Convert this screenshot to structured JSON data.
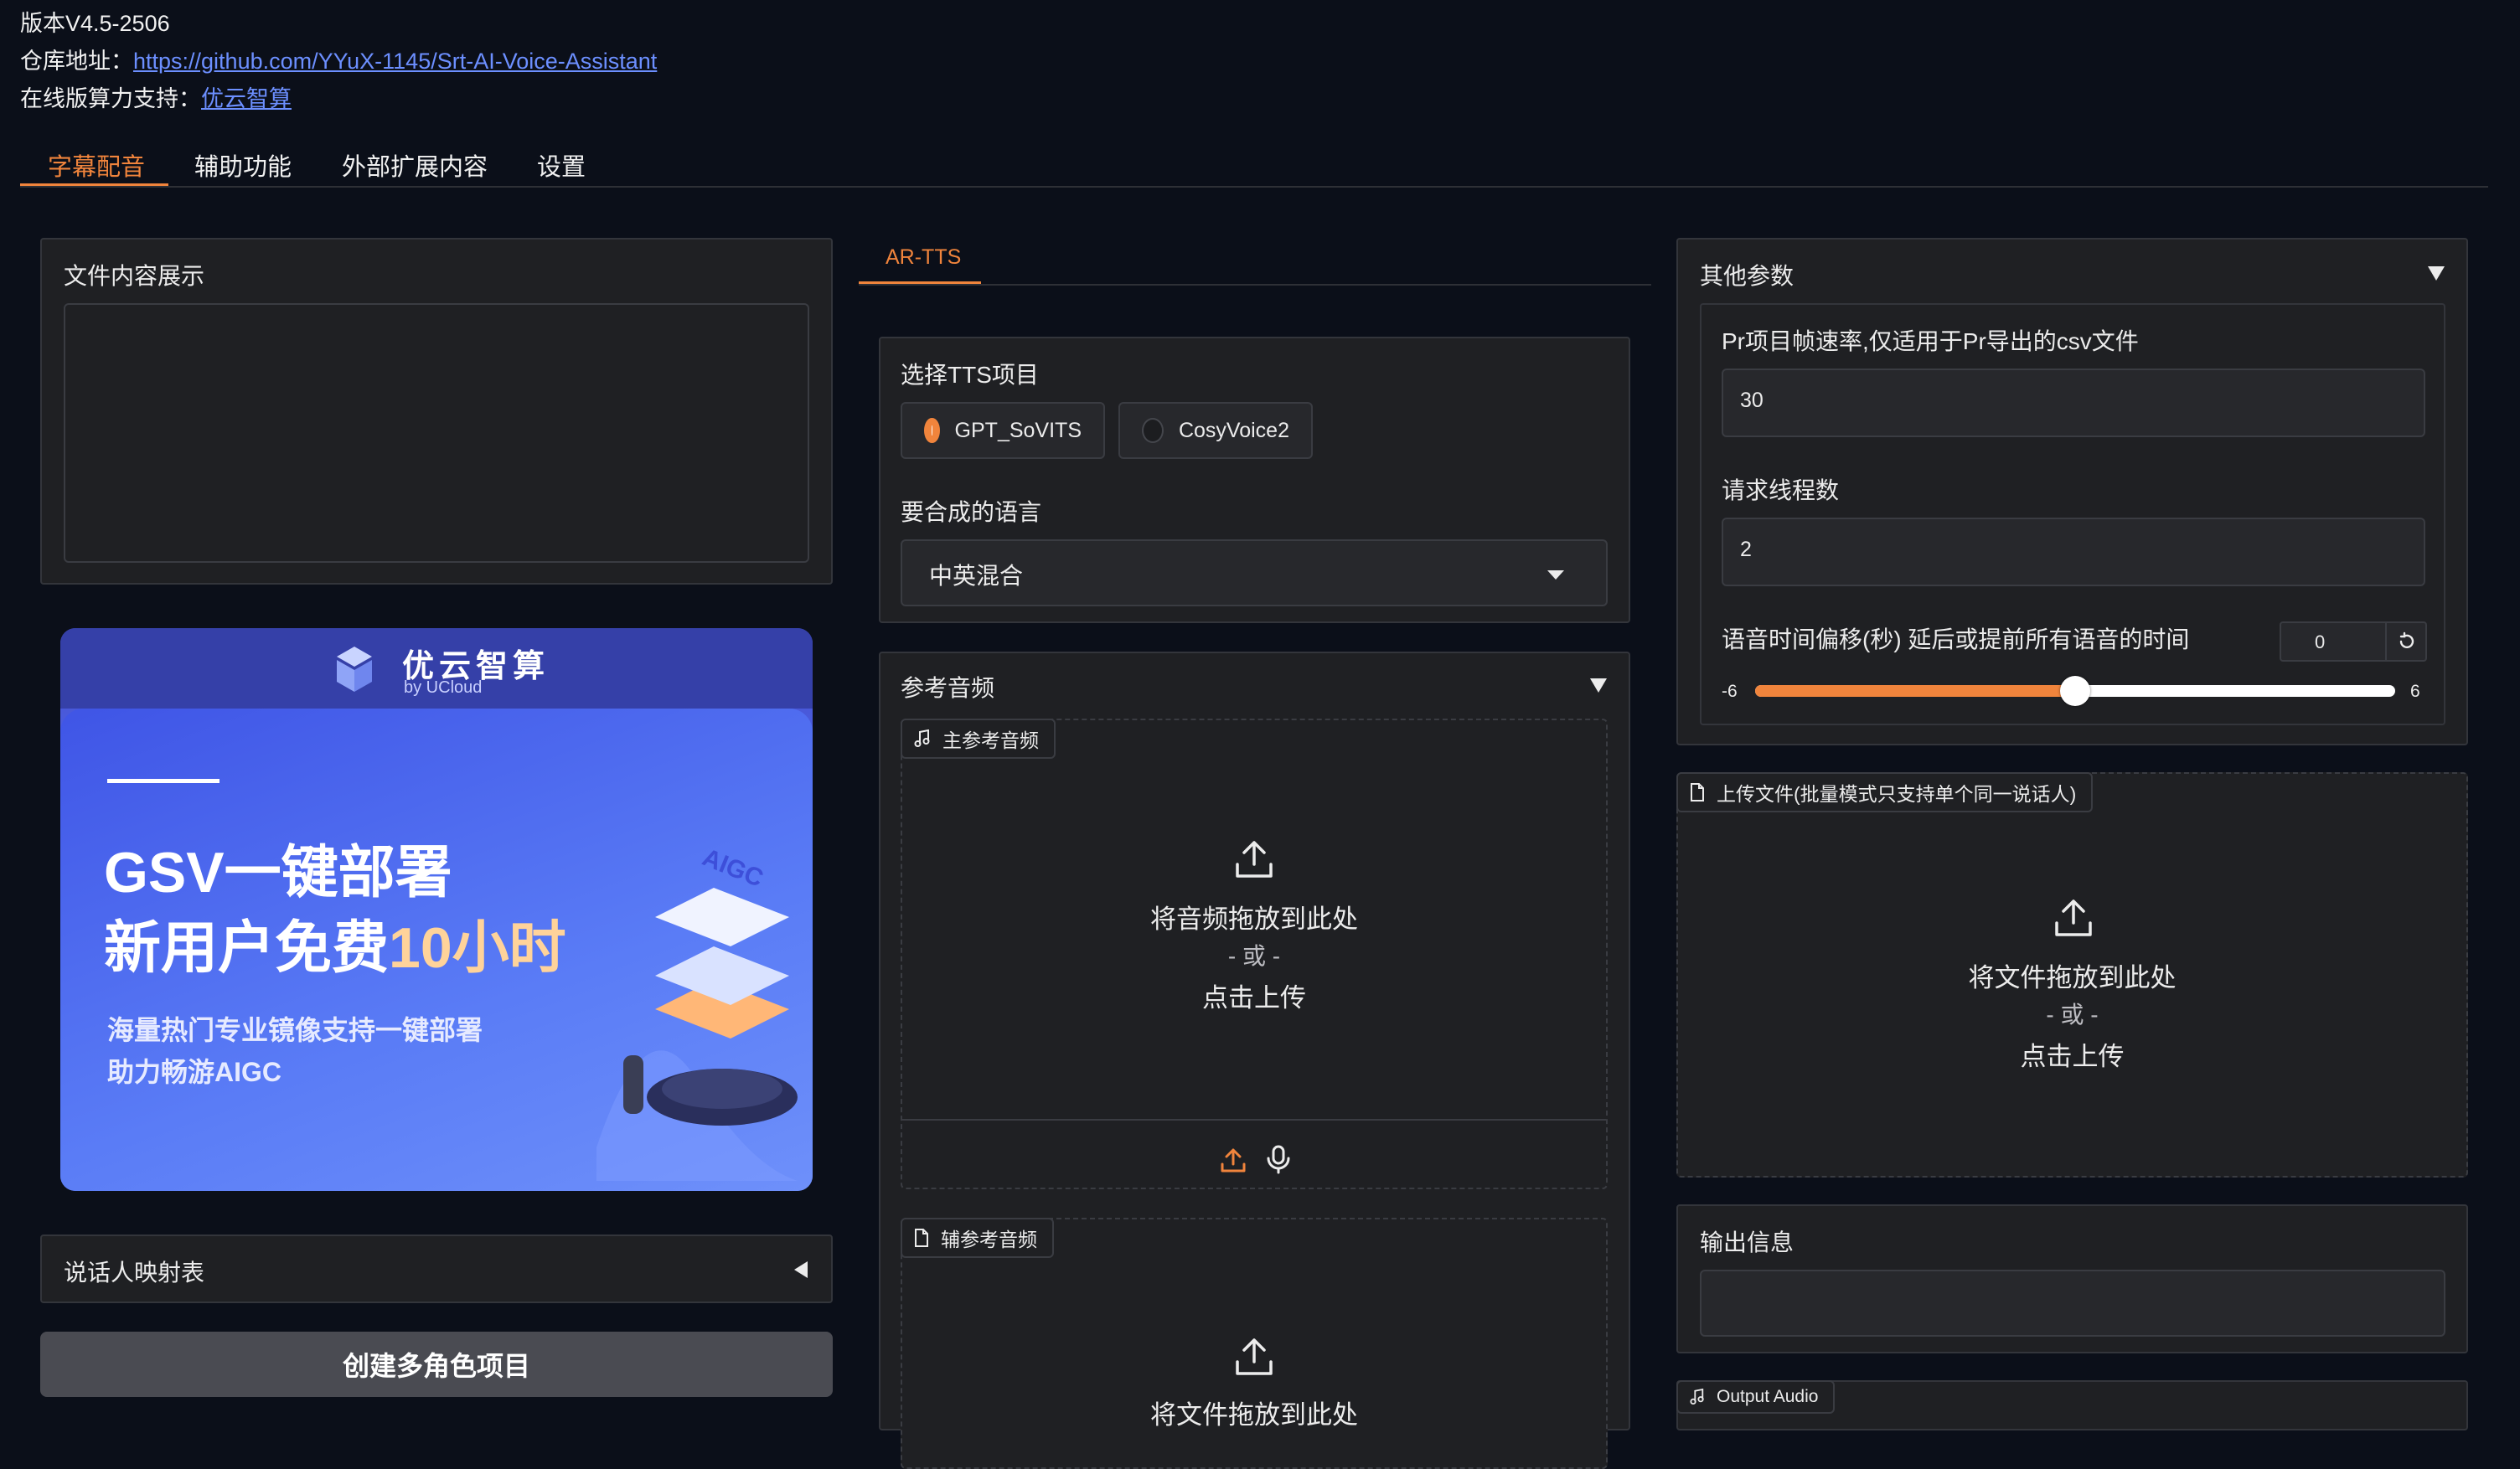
{
  "header": {
    "version": "版本V4.5-2506",
    "repo_label": "仓库地址：",
    "repo_url": "https://github.com/YYuX-1145/Srt-AI-Voice-Assistant",
    "online_label": "在线版算力支持：",
    "online_link": "优云智算"
  },
  "tabs": [
    {
      "label": "字幕配音",
      "active": true
    },
    {
      "label": "辅助功能",
      "active": false
    },
    {
      "label": "外部扩展内容",
      "active": false
    },
    {
      "label": "设置",
      "active": false
    }
  ],
  "left": {
    "file_content_label": "文件内容展示",
    "banner": {
      "brand": "优云智算",
      "brand_sub": "by UCloud",
      "headline1": "GSV一键部署",
      "headline2_prefix": "新用户免费",
      "headline2_highlight": "10小时",
      "line1": "海量热门专业镜像支持一键部署",
      "line2": "助力畅游AIGC",
      "tag": "AIGC"
    },
    "speaker_map_label": "说话人映射表",
    "create_button": "创建多角色项目"
  },
  "middle": {
    "tab": "AR-TTS",
    "tts_label": "选择TTS项目",
    "tts_options": [
      {
        "label": "GPT_SoVITS",
        "selected": true
      },
      {
        "label": "CosyVoice2",
        "selected": false
      }
    ],
    "lang_label": "要合成的语言",
    "lang_value": "中英混合",
    "ref_audio_label": "参考音频",
    "main_ref_badge": "主参考音频",
    "drop_audio": "将音频拖放到此处",
    "or": "- 或 -",
    "click_upload": "点击上传",
    "aux_ref_badge": "辅参考音频",
    "drop_file_partial": "将文件拖放到此处"
  },
  "right": {
    "other_params_label": "其他参数",
    "fps_label": "Pr项目帧速率,仅适用于Pr导出的csv文件",
    "fps_value": "30",
    "threads_label": "请求线程数",
    "threads_value": "2",
    "offset_label": "语音时间偏移(秒) 延后或提前所有语音的时间",
    "offset_value": "0",
    "slider": {
      "min": "-6",
      "max": "6",
      "value": 0
    },
    "upload_badge": "上传文件(批量模式只支持单个同一说话人)",
    "drop_file": "将文件拖放到此处",
    "or": "- 或 -",
    "click_upload": "点击上传",
    "output_info_label": "输出信息",
    "output_audio_badge": "Output Audio"
  },
  "colors": {
    "accent": "#f0843c",
    "link": "#6c8fff",
    "panel": "#1f2023",
    "background": "#0b0f19"
  }
}
